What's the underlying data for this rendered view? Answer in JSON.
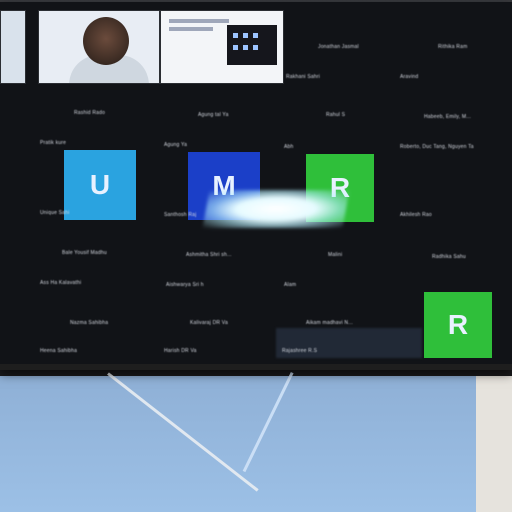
{
  "participants": {
    "avatars": [
      {
        "letter": "U",
        "color": "#2aa3e0"
      },
      {
        "letter": "M",
        "color": "#1b3fc8"
      },
      {
        "letter": "R",
        "color": "#2fbf3a"
      },
      {
        "letter": "R",
        "color": "#2fbf3a"
      }
    ],
    "names": [
      "Rashid Rado",
      "Agung tal Ya",
      "Rahul S",
      "Habeeb, Emily, M...",
      "Pratik kure",
      "Agung Ya",
      "Abh",
      "Roberto, Duc Tang, Nguyen Ta",
      "Unique Sahi",
      "Santhosh Raj",
      "Akhilesh Rao",
      "Bale Yousif Madhu",
      "Ashmitha Shri sh...",
      "Malini",
      "Radhika Sahu",
      "Ass Ha Kalavathi",
      "Aishwarya Sri h",
      "Alam",
      "Nazma Sahibha",
      "Kalivaraj DR Va",
      "Aikam madhavi N...",
      "Heena Sahibha",
      "Harish DR Va",
      "Rajashree R.S"
    ],
    "top_labels": [
      "Jonathan Jasmal",
      "Rithika Ram",
      "Rakhani Sahri",
      "Aravind"
    ]
  },
  "colors": {
    "screen_bg": "#111317",
    "avatar_blue": "#2aa3e0",
    "avatar_darkblue": "#1b3fc8",
    "avatar_green": "#2fbf3a"
  }
}
